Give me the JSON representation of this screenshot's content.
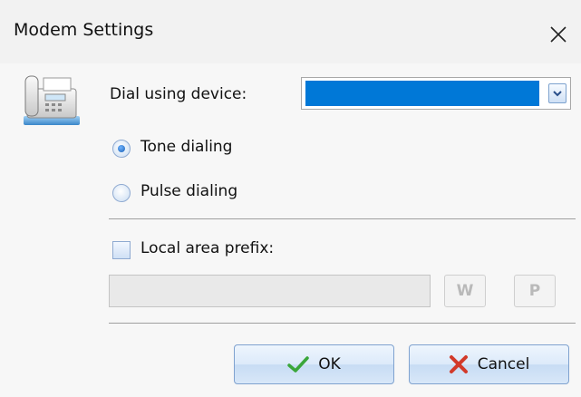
{
  "window": {
    "title": "Modem Settings"
  },
  "dial": {
    "label": "Dial using device:",
    "selected_value": ""
  },
  "dialing_mode": {
    "options": [
      {
        "label": "Tone dialing",
        "checked": true
      },
      {
        "label": "Pulse dialing",
        "checked": false
      }
    ]
  },
  "local_prefix": {
    "label": "Local area prefix:",
    "checked": false,
    "value": "",
    "w_label": "W",
    "p_label": "P"
  },
  "buttons": {
    "ok_label": "OK",
    "cancel_label": "Cancel"
  },
  "colors": {
    "selection": "#0078d7",
    "ok_check": "#3aa63a",
    "cancel_x": "#d23a2a"
  },
  "icons": {
    "device": "fax-phone-icon",
    "close": "close-icon",
    "dropdown": "chevron-down-icon",
    "ok": "checkmark-icon",
    "cancel": "x-mark-icon"
  }
}
